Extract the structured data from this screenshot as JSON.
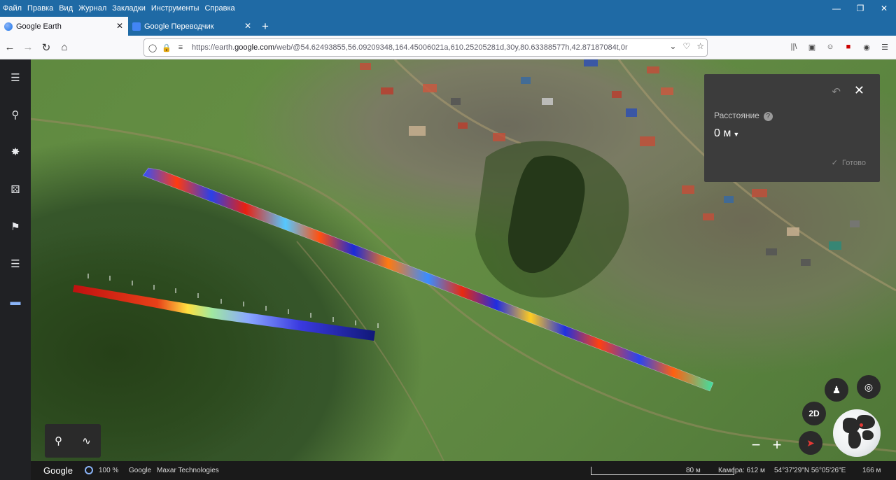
{
  "menu": [
    "Файл",
    "Правка",
    "Вид",
    "Журнал",
    "Закладки",
    "Инструменты",
    "Справка"
  ],
  "window_controls": {
    "minimize": "—",
    "maximize": "❐",
    "close": "✕"
  },
  "tabs": [
    {
      "title": "Google Earth",
      "active": true,
      "icon": "google-earth-icon"
    },
    {
      "title": "Google Переводчик",
      "active": false,
      "icon": "google-translate-icon"
    }
  ],
  "url": {
    "prefix": "https://earth.",
    "domain": "google.com",
    "rest": "/web/@54.62493855,56.09209348,164.45006021a,610.25205281d,30y,80.63388577h,42.87187084t,0r"
  },
  "panel": {
    "label": "Расстояние",
    "value": "0 м",
    "done": "Готово"
  },
  "map_controls": {
    "mode_2d": "2D"
  },
  "status": {
    "logo": "Google",
    "zoom": "100 %",
    "attr_google": "Google",
    "attr_maxar": "Maxar Technologies",
    "scale": "80 м",
    "camera": "Камера: 612 м",
    "coords": "54°37'29\"N 56°05'26\"E",
    "altitude": "166 м"
  },
  "colors": {
    "chrome": "#1f6aa5",
    "sidebar": "#202124",
    "panel": "#3c3c3c"
  }
}
